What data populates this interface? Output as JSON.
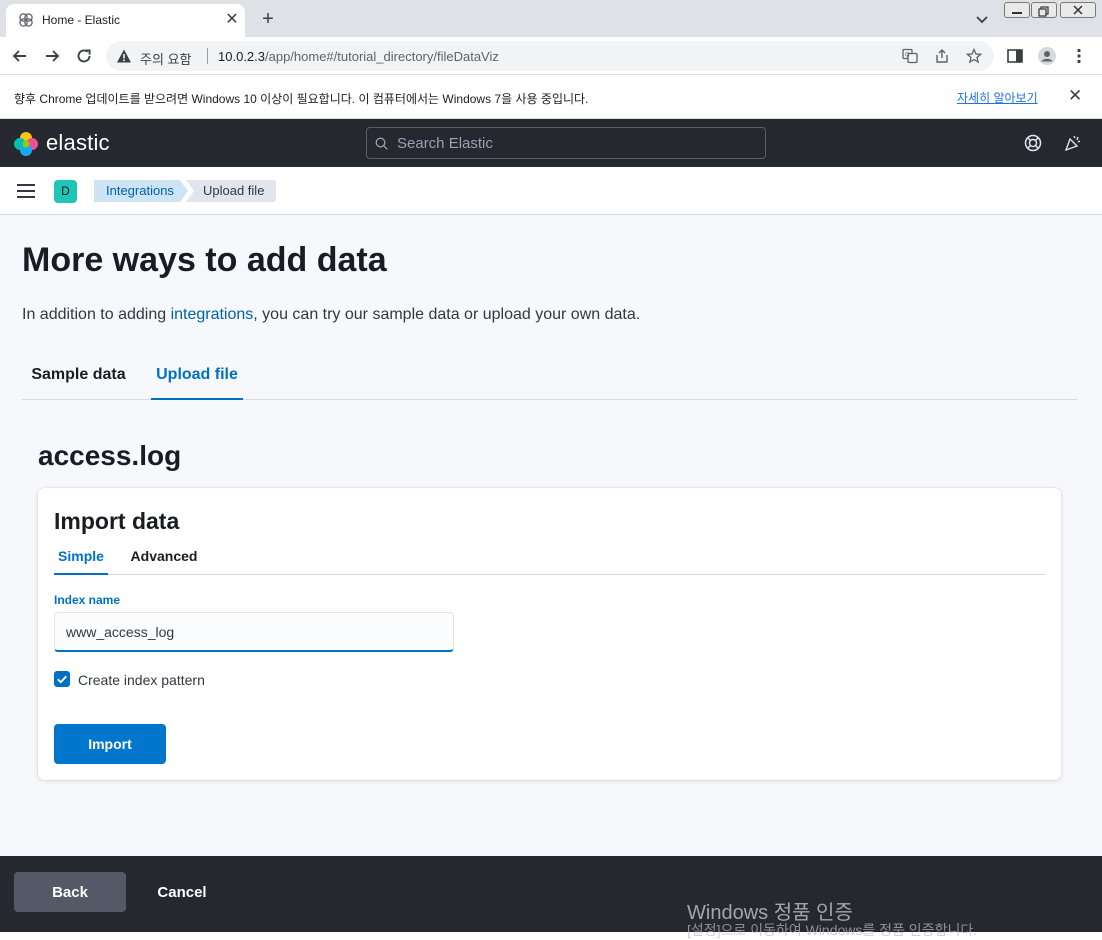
{
  "browser": {
    "tab_title": "Home - Elastic",
    "new_tab_label": "+",
    "security_warning": "주의 요함",
    "url_host": "10.0.2.3",
    "url_path": "/app/home#/tutorial_directory/fileDataViz"
  },
  "infobar": {
    "message": "향후 Chrome 업데이트를 받으려면 Windows 10 이상이 필요합니다. 이 컴퓨터에서는 Windows 7을 사용 중입니다.",
    "link": "자세히 알아보기"
  },
  "header": {
    "logo_text": "elastic",
    "search_placeholder": "Search Elastic"
  },
  "subheader": {
    "space_initial": "D",
    "breadcrumbs": [
      "Integrations",
      "Upload file"
    ]
  },
  "page": {
    "title": "More ways to add data",
    "desc_prefix": "In addition to adding ",
    "desc_link": "integrations",
    "desc_suffix": ", you can try our sample data or upload your own data.",
    "tabs": [
      "Sample data",
      "Upload file"
    ],
    "file_name": "access.log"
  },
  "import_panel": {
    "title": "Import data",
    "tabs": [
      "Simple",
      "Advanced"
    ],
    "index_label": "Index name",
    "index_value": "www_access_log",
    "checkbox_label": "Create index pattern",
    "checkbox_checked": true,
    "import_button": "Import"
  },
  "footer": {
    "back_button": "Back",
    "cancel_button": "Cancel"
  },
  "watermark": {
    "title": "Windows 정품 인증",
    "subtitle": "[설정]으로 이동하여 Windows를 정품 인증합니다."
  },
  "colors": {
    "primary": "#0077cc",
    "header_bg": "#25282f",
    "page_bg": "#f7f8fc",
    "avatar": "#20c5b5"
  }
}
